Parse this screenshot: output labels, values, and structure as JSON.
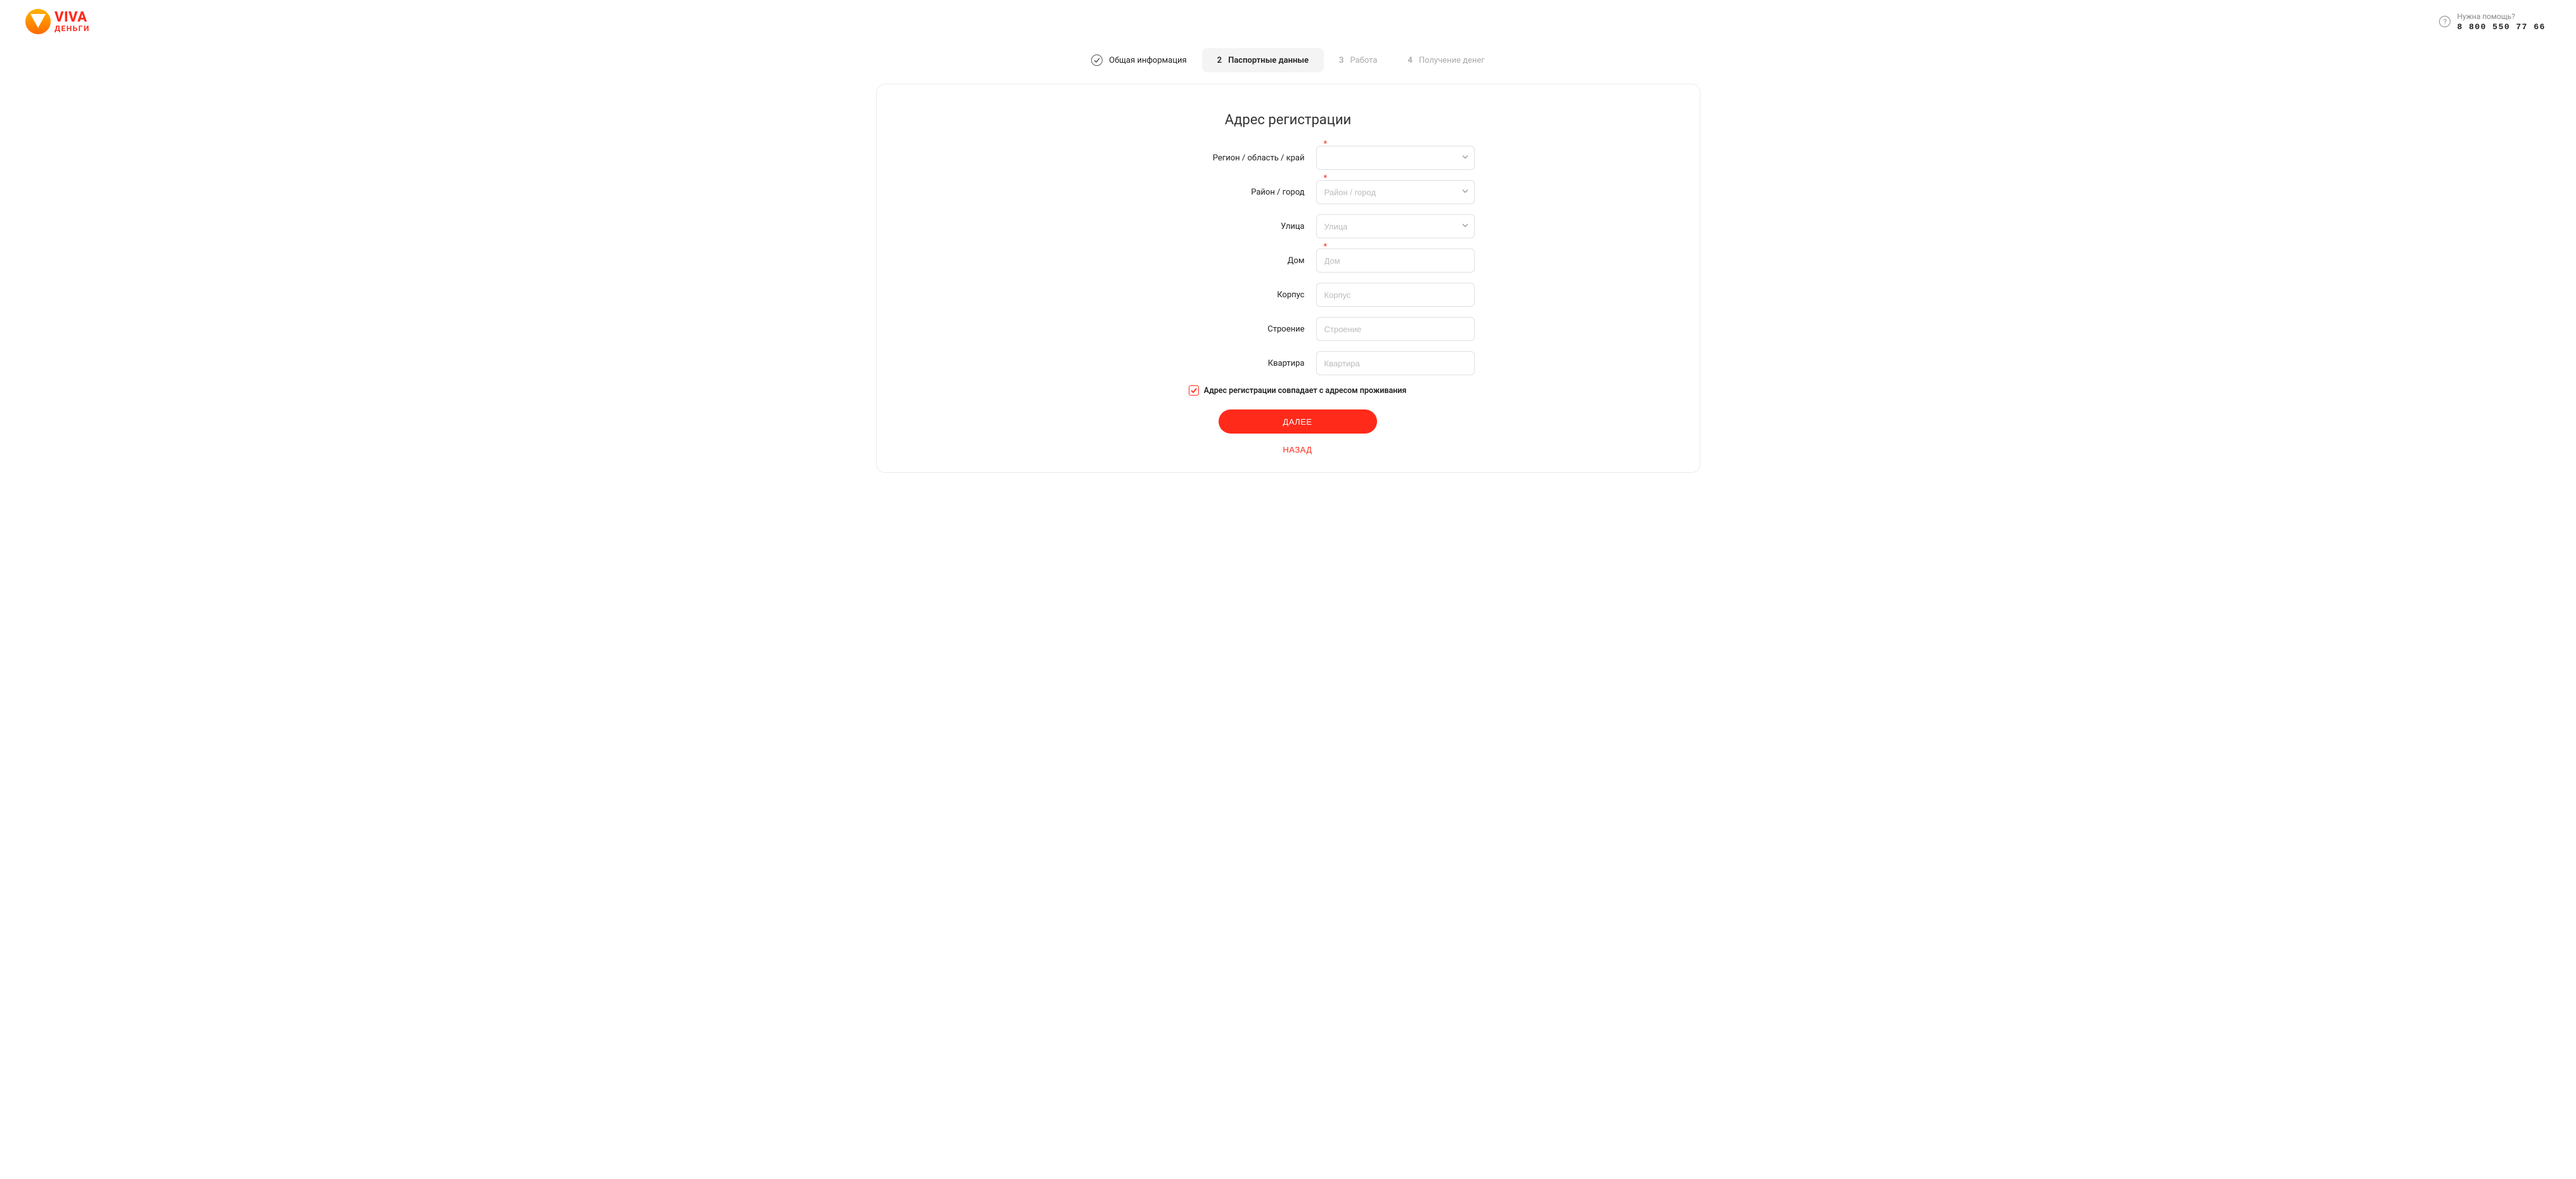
{
  "header": {
    "logo": {
      "line1": "VIVA",
      "line2": "ДЕНЬГИ"
    },
    "help": {
      "label": "Нужна помощь?",
      "phone": "8 800 550 77 66"
    }
  },
  "steps": [
    {
      "num": "",
      "label": "Общая информация",
      "state": "done"
    },
    {
      "num": "2",
      "label": "Паспортные данные",
      "state": "active"
    },
    {
      "num": "3",
      "label": "Работа",
      "state": "pending"
    },
    {
      "num": "4",
      "label": "Получение денег",
      "state": "pending"
    }
  ],
  "form": {
    "title": "Адрес регистрации",
    "fields": {
      "region": {
        "label": "Регион / область / край",
        "placeholder": "",
        "required": true,
        "dropdown": true,
        "value": ""
      },
      "city": {
        "label": "Район / город",
        "placeholder": "Район / город",
        "required": true,
        "dropdown": true,
        "value": ""
      },
      "street": {
        "label": "Улица",
        "placeholder": "Улица",
        "required": false,
        "dropdown": true,
        "value": ""
      },
      "house": {
        "label": "Дом",
        "placeholder": "Дом",
        "required": true,
        "dropdown": false,
        "value": ""
      },
      "korpus": {
        "label": "Корпус",
        "placeholder": "Корпус",
        "required": false,
        "dropdown": false,
        "value": ""
      },
      "building": {
        "label": "Строение",
        "placeholder": "Строение",
        "required": false,
        "dropdown": false,
        "value": ""
      },
      "flat": {
        "label": "Квартира",
        "placeholder": "Квартира",
        "required": false,
        "dropdown": false,
        "value": ""
      }
    },
    "checkbox": {
      "label": "Адрес регистрации совпадает с адресом проживания",
      "checked": true
    },
    "buttons": {
      "next": "ДАЛЕЕ",
      "back": "НАЗАД"
    }
  }
}
